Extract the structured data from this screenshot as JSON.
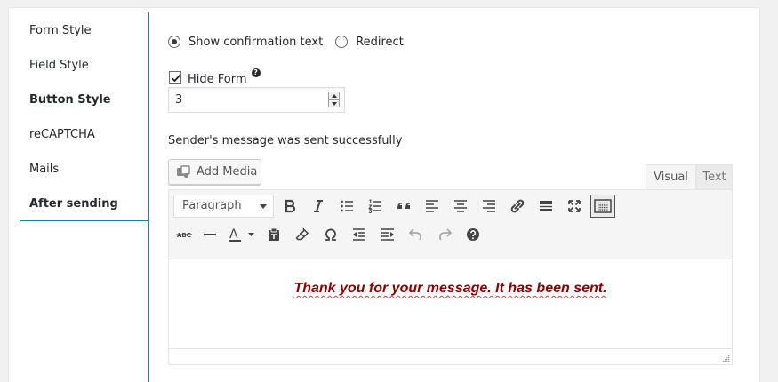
{
  "sidebar": {
    "items": [
      {
        "label": "Form Style"
      },
      {
        "label": "Field Style"
      },
      {
        "label": "Button Style"
      },
      {
        "label": "reCAPTCHA"
      },
      {
        "label": "Mails"
      },
      {
        "label": "After sending"
      }
    ]
  },
  "confirmation": {
    "options": [
      "Show confirmation text",
      "Redirect"
    ],
    "selected": "Show confirmation text"
  },
  "hide_form": {
    "label": "Hide Form",
    "checked": true,
    "help_icon": "question-circle-icon",
    "value": "3"
  },
  "message": {
    "label": "Sender's message was sent successfully",
    "add_media_label": "Add Media",
    "tabs": [
      "Visual",
      "Text"
    ],
    "active_tab": "Visual",
    "format_value": "Paragraph",
    "body_text": "Thank you for your message. It has been sent.",
    "body_color": "#8b0000"
  },
  "toolbar": {
    "row1": [
      "bold-icon",
      "italic-icon",
      "bullet-list-icon",
      "numbered-list-icon",
      "blockquote-icon",
      "align-left-icon",
      "align-center-icon",
      "align-right-icon",
      "link-icon",
      "read-more-icon",
      "fullscreen-icon",
      "toolbar-toggle-icon"
    ],
    "row2": [
      "strikethrough-icon",
      "horizontal-line-icon",
      "text-color-icon",
      "paste-text-icon",
      "clear-formatting-icon",
      "special-character-icon",
      "outdent-icon",
      "indent-icon",
      "undo-icon",
      "redo-icon",
      "help-icon"
    ],
    "strikethrough_glyph": "ABC",
    "text_color_glyph": "A"
  },
  "colors": {
    "accent": "#0e8d9c",
    "panel_bg": "#ffffff",
    "page_bg": "#f1f1f1"
  }
}
